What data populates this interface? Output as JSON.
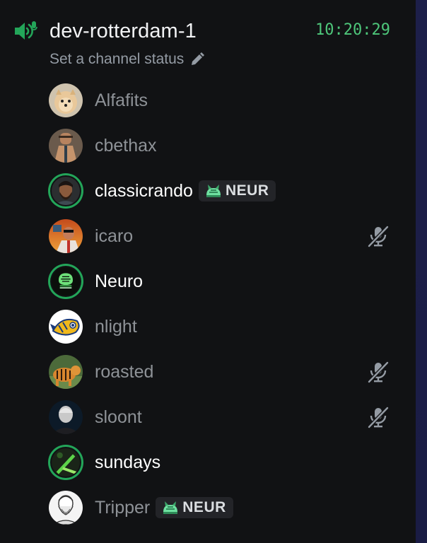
{
  "channel": {
    "name": "dev-rotterdam-1",
    "time": "10:20:29",
    "status_placeholder": "Set a channel status",
    "icon": "voice-channel-speaker-icon"
  },
  "colors": {
    "background": "#111214",
    "speaking_ring": "#23a559",
    "clock": "#4ec67a",
    "muted_text": "#8e9297",
    "tag_bg": "#232428"
  },
  "members": [
    {
      "name": "Alfafits",
      "speaking": false,
      "muted": false,
      "tag": null,
      "avatar": "pomeranian-dog-avatar"
    },
    {
      "name": "cbethax",
      "speaking": false,
      "muted": false,
      "tag": null,
      "avatar": "cartoon-man-avatar"
    },
    {
      "name": "classicrando",
      "speaking": true,
      "muted": false,
      "tag": "NEUR",
      "avatar": "bearded-man-avatar"
    },
    {
      "name": "icaro",
      "speaking": false,
      "muted": true,
      "tag": null,
      "avatar": "sunset-man-avatar"
    },
    {
      "name": "Neuro",
      "speaking": true,
      "muted": false,
      "tag": null,
      "avatar": "green-brain-logo-avatar"
    },
    {
      "name": "nlight",
      "speaking": false,
      "muted": false,
      "tag": null,
      "avatar": "yellow-fish-avatar"
    },
    {
      "name": "roasted",
      "speaking": false,
      "muted": true,
      "tag": null,
      "avatar": "tiger-avatar"
    },
    {
      "name": "sloont",
      "speaking": false,
      "muted": true,
      "tag": null,
      "avatar": "pale-man-avatar"
    },
    {
      "name": "sundays",
      "speaking": true,
      "muted": false,
      "tag": null,
      "avatar": "green-blade-avatar"
    },
    {
      "name": "Tripper",
      "speaking": false,
      "muted": false,
      "tag": "NEUR",
      "avatar": "philosopher-bust-avatar"
    }
  ]
}
